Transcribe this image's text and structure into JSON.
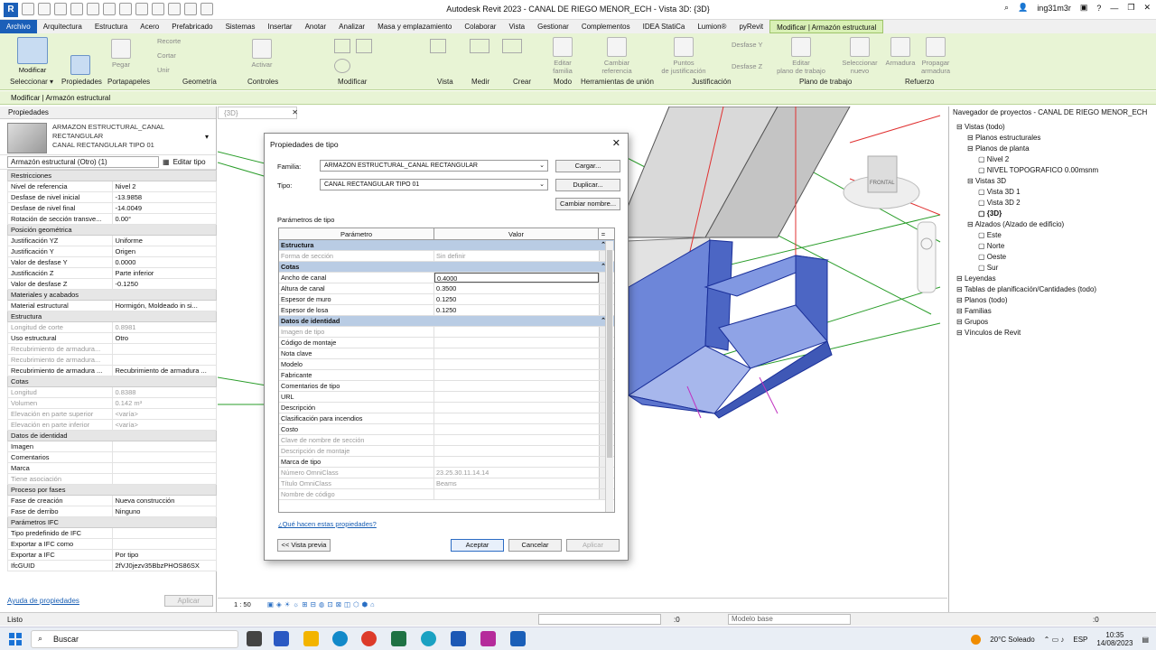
{
  "titlebar": {
    "app_icon": "R",
    "title": "Autodesk Revit 2023 - CANAL DE RIEGO MENOR_ECH - Vista 3D: {3D}",
    "user": "ing31m3r"
  },
  "menu": [
    "Archivo",
    "Arquitectura",
    "Estructura",
    "Acero",
    "Prefabricado",
    "Sistemas",
    "Insertar",
    "Anotar",
    "Analizar",
    "Masa y emplazamiento",
    "Colaborar",
    "Vista",
    "Gestionar",
    "Complementos",
    "IDEA StatiCa",
    "Lumion®",
    "pyRevit",
    "Modificar | Armazón estructural"
  ],
  "ribbon": {
    "buttons": {
      "modify": "Modificar",
      "paste": "Pegar",
      "activate": "Activar",
      "edit_family": "Editar\nfamilia",
      "change_ref": "Cambiar\nreferencia",
      "just_points": "Puntos\nde justificación",
      "edit_workplane": "Editar\nplano de trabajo",
      "select_new": "Seleccionar\nnuevo",
      "rebar": "Armadura",
      "propagate": "Propagar\narmadura",
      "cut": "Recorte",
      "cortar": "Cortar",
      "unir": "Unir",
      "offset_y": "Desfase Y",
      "offset_z": "Desfase Z"
    },
    "panels": {
      "select": "Seleccionar ▾",
      "properties": "Propiedades",
      "clipboard": "Portapapeles",
      "geometry": "Geometría",
      "controls": "Controles",
      "modify": "Modificar",
      "view": "Vista",
      "measure": "Medir",
      "create": "Crear",
      "mode": "Modo",
      "join_tools": "Herramientas de unión",
      "justification": "Justificación",
      "workplane": "Plano de trabajo",
      "reinforcement": "Refuerzo"
    }
  },
  "context_bar": "Modificar | Armazón estructural",
  "properties": {
    "header": "Propiedades",
    "type_lines": [
      "ARMAZON ESTRUCTURAL_CANAL",
      "RECTANGULAR",
      "CANAL RECTANGULAR TIPO 01"
    ],
    "selector": "Armazón estructural (Otro) (1)",
    "edit_type": "Editar tipo",
    "rows": [
      {
        "g": "Restricciones"
      },
      {
        "k": "Nivel de referencia",
        "v": "Nivel 2"
      },
      {
        "k": "Desfase de nivel inicial",
        "v": "-13.9858"
      },
      {
        "k": "Desfase de nivel final",
        "v": "-14.0049"
      },
      {
        "k": "Rotación de sección transve...",
        "v": "0.00°"
      },
      {
        "g": "Posición geométrica"
      },
      {
        "k": "Justificación YZ",
        "v": "Uniforme"
      },
      {
        "k": "Justificación Y",
        "v": "Origen"
      },
      {
        "k": "Valor de desfase Y",
        "v": "0.0000"
      },
      {
        "k": "Justificación Z",
        "v": "Parte inferior"
      },
      {
        "k": "Valor de desfase Z",
        "v": "-0.1250"
      },
      {
        "g": "Materiales y acabados"
      },
      {
        "k": "Material estructural",
        "v": "Hormigón, Moldeado in si..."
      },
      {
        "g": "Estructura"
      },
      {
        "k": "Longitud de corte",
        "v": "0.8981",
        "d": true
      },
      {
        "k": "Uso estructural",
        "v": "Otro"
      },
      {
        "k": "Recubrimiento de armadura...",
        "v": "",
        "d": true
      },
      {
        "k": "Recubrimiento de armadura...",
        "v": "",
        "d": true
      },
      {
        "k": "Recubrimiento de armadura ...",
        "v": "Recubrimiento de armadura ..."
      },
      {
        "g": "Cotas"
      },
      {
        "k": "Longitud",
        "v": "0.8388",
        "d": true
      },
      {
        "k": "Volumen",
        "v": "0.142 m³",
        "d": true
      },
      {
        "k": "Elevación en parte superior",
        "v": "<varía>",
        "d": true
      },
      {
        "k": "Elevación en parte inferior",
        "v": "<varía>",
        "d": true
      },
      {
        "g": "Datos de identidad"
      },
      {
        "k": "Imagen",
        "v": ""
      },
      {
        "k": "Comentarios",
        "v": ""
      },
      {
        "k": "Marca",
        "v": ""
      },
      {
        "k": "Tiene asociación",
        "v": "",
        "d": true
      },
      {
        "g": "Proceso por fases"
      },
      {
        "k": "Fase de creación",
        "v": "Nueva construcción"
      },
      {
        "k": "Fase de derribo",
        "v": "Ninguno"
      },
      {
        "g": "Parámetros IFC"
      },
      {
        "k": "Tipo predefinido de IFC",
        "v": ""
      },
      {
        "k": "Exportar a IFC como",
        "v": ""
      },
      {
        "k": "Exportar a IFC",
        "v": "Por tipo"
      },
      {
        "k": "IfcGUID",
        "v": "2fVJ0jezv35BbzPHOS86SX"
      }
    ],
    "help": "Ayuda de propiedades",
    "apply": "Aplicar"
  },
  "view_tab": "{3D}",
  "view_cube_label": "FRONTAL",
  "view_controls": "1 : 50",
  "browser": {
    "header": "Navegador de proyectos - CANAL DE RIEGO MENOR_ECH",
    "nodes": [
      {
        "t": "Vistas (todo)",
        "lvl": 0
      },
      {
        "t": "Planos estructurales",
        "lvl": 1
      },
      {
        "t": "Planos de planta",
        "lvl": 1
      },
      {
        "t": "Nivel 2",
        "lvl": 2
      },
      {
        "t": "NIVEL TOPOGRAFICO 0.00msnm",
        "lvl": 2
      },
      {
        "t": "Vistas 3D",
        "lvl": 1
      },
      {
        "t": "Vista 3D 1",
        "lvl": 2
      },
      {
        "t": "Vista 3D 2",
        "lvl": 2
      },
      {
        "t": "{3D}",
        "lvl": 2,
        "b": true
      },
      {
        "t": "Alzados (Alzado de edificio)",
        "lvl": 1
      },
      {
        "t": "Este",
        "lvl": 2
      },
      {
        "t": "Norte",
        "lvl": 2
      },
      {
        "t": "Oeste",
        "lvl": 2
      },
      {
        "t": "Sur",
        "lvl": 2
      },
      {
        "t": "Leyendas",
        "lvl": 0
      },
      {
        "t": "Tablas de planificación/Cantidades (todo)",
        "lvl": 0
      },
      {
        "t": "Planos (todo)",
        "lvl": 0
      },
      {
        "t": "Familias",
        "lvl": 0
      },
      {
        "t": "Grupos",
        "lvl": 0
      },
      {
        "t": "Vínculos de Revit",
        "lvl": 0
      }
    ]
  },
  "dialog": {
    "title": "Propiedades de tipo",
    "family_label": "Familia:",
    "family_value": "ARMAZON ESTRUCTURAL_CANAL RECTANGULAR",
    "type_label": "Tipo:",
    "type_value": "CANAL RECTANGULAR TIPO 01",
    "load": "Cargar...",
    "duplicate": "Duplicar...",
    "rename": "Cambiar nombre...",
    "params_label": "Parámetros de tipo",
    "col_param": "Parámetro",
    "col_value": "Valor",
    "rows": [
      {
        "g": "Estructura"
      },
      {
        "k": "Forma de sección",
        "v": "Sin definir",
        "d": true
      },
      {
        "g": "Cotas"
      },
      {
        "k": "Ancho de canal",
        "v": "0.4000",
        "s": true
      },
      {
        "k": "Altura de canal",
        "v": "0.3500"
      },
      {
        "k": "Espesor de muro",
        "v": "0.1250"
      },
      {
        "k": "Espesor de losa",
        "v": "0.1250"
      },
      {
        "g": "Datos de identidad"
      },
      {
        "k": "Imagen de tipo",
        "v": "",
        "d": true
      },
      {
        "k": "Código de montaje",
        "v": ""
      },
      {
        "k": "Nota clave",
        "v": ""
      },
      {
        "k": "Modelo",
        "v": ""
      },
      {
        "k": "Fabricante",
        "v": ""
      },
      {
        "k": "Comentarios de tipo",
        "v": ""
      },
      {
        "k": "URL",
        "v": ""
      },
      {
        "k": "Descripción",
        "v": ""
      },
      {
        "k": "Clasificación para incendios",
        "v": ""
      },
      {
        "k": "Costo",
        "v": ""
      },
      {
        "k": "Clave de nombre de sección",
        "v": "",
        "d": true
      },
      {
        "k": "Descripción de montaje",
        "v": "",
        "d": true
      },
      {
        "k": "Marca de tipo",
        "v": ""
      },
      {
        "k": "Número OmniClass",
        "v": "23.25.30.11.14.14",
        "d": true
      },
      {
        "k": "Título OmniClass",
        "v": "Beams",
        "d": true
      },
      {
        "k": "Nombre de código",
        "v": "",
        "d": true
      }
    ],
    "help_link": "¿Qué hacen estas propiedades?",
    "preview": "<< Vista previa",
    "ok": "Aceptar",
    "cancel": "Cancelar",
    "apply": "Aplicar"
  },
  "status": {
    "left": "Listo",
    "filter": ":0",
    "model": "Modelo base",
    "sel": ":0"
  },
  "taskbar": {
    "search": "Buscar",
    "weather": "20°C  Soleado",
    "lang": "ESP",
    "time": "10:35",
    "date": "14/08/2023"
  }
}
